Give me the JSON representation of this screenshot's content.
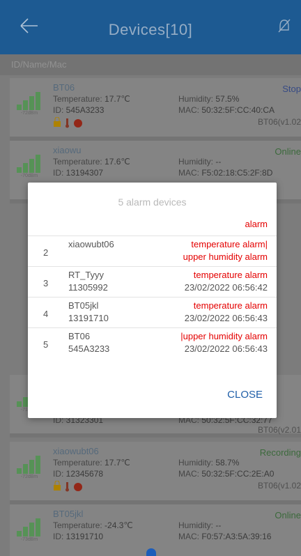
{
  "header": {
    "title": "Devices[10]"
  },
  "search": {
    "placeholder": "ID/Name/Mac"
  },
  "labels": {
    "temperature": "Temperature: ",
    "humidity": "Humidity: ",
    "id": "ID: ",
    "mac": "MAC: "
  },
  "devices": [
    {
      "name": "BT06",
      "temperature": "17.7℃",
      "humidity": "57.5%",
      "id": "545A3233",
      "mac": "50:32:5F:CC:40:CA",
      "status": "Stop",
      "version": "BT06(v1.02",
      "rssi": "-72dBm"
    },
    {
      "name": "xiaowu",
      "temperature": "17.6℃",
      "humidity": "--",
      "id": "13194307",
      "mac": "F5:02:18:C5:2F:8D",
      "status": "Online",
      "version": "",
      "rssi": "-70dBm"
    },
    {
      "name": "",
      "temperature": "",
      "humidity": "",
      "id": "31323301",
      "mac": "50:32:5F:CC:32:77",
      "status": "",
      "version": "BT06(v2.01",
      "rssi": "-71dBm"
    },
    {
      "name": "xiaowubt06",
      "temperature": "17.7℃",
      "humidity": "58.7%",
      "id": "12345678",
      "mac": "50:32:5F:CC:2E:A0",
      "status": "Recording",
      "version": "BT06(v1.02",
      "rssi": "-72dBm"
    },
    {
      "name": "BT05jkl",
      "temperature": "-24.3℃",
      "humidity": "--",
      "id": "13191710",
      "mac": "F0:57:A3:5A:39:16",
      "status": "Online",
      "version": "",
      "rssi": "-73dBm"
    }
  ],
  "dialog": {
    "title": "5 alarm devices",
    "first_partial": "alarm",
    "rows": [
      {
        "num": "2",
        "name": "xiaowubt06",
        "sub": "",
        "alarm1": "temperature alarm|",
        "alarm2": "upper humidity alarm",
        "alarm2_red": true
      },
      {
        "num": "3",
        "name": "RT_Tyyy",
        "sub": "11305992",
        "alarm1": "temperature alarm",
        "alarm2": "23/02/2022 06:56:42",
        "alarm2_red": false
      },
      {
        "num": "4",
        "name": "BT05jkl",
        "sub": "13191710",
        "alarm1": "temperature alarm",
        "alarm2": "23/02/2022 06:56:43",
        "alarm2_red": false
      },
      {
        "num": "5",
        "name": "BT06",
        "sub": "545A3233",
        "alarm1": "|upper humidity alarm",
        "alarm2": "23/02/2022 06:56:43",
        "alarm2_red": false
      }
    ],
    "close_label": "CLOSE"
  }
}
